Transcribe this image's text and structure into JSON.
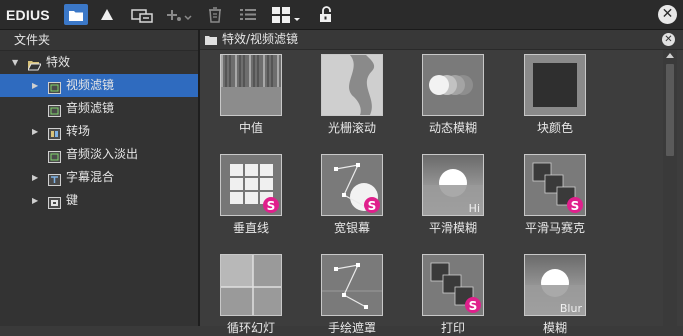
{
  "app": {
    "brand": "EDIUS"
  },
  "toolbar": {
    "buttons": [
      {
        "name": "folder-view-button",
        "icon": "folder-icon",
        "active": true
      },
      {
        "name": "effect-up-button",
        "icon": "triangle-icon"
      },
      {
        "name": "effect-link-button",
        "icon": "link-box-icon"
      },
      {
        "name": "add-effect-button",
        "icon": "plus-chevron-icon"
      },
      {
        "name": "delete-button",
        "icon": "trash-icon"
      },
      {
        "name": "list-view-button",
        "icon": "list-icon"
      },
      {
        "name": "grid-view-button",
        "icon": "grid-icon"
      },
      {
        "name": "lock-button",
        "icon": "unlock-icon"
      }
    ]
  },
  "left_panel": {
    "title": "文件夹",
    "tree": [
      {
        "label": "特效",
        "level": 0,
        "expanded": true,
        "icon": "folder-open-icon"
      },
      {
        "label": "视频滤镜",
        "level": 1,
        "expander": true,
        "icon": "filter-icon",
        "selected": true
      },
      {
        "label": "音频滤镜",
        "level": 1,
        "expander": false,
        "icon": "filter-icon"
      },
      {
        "label": "转场",
        "level": 1,
        "expander": true,
        "icon": "transition-icon"
      },
      {
        "label": "音频淡入淡出",
        "level": 1,
        "expander": false,
        "icon": "filter-icon"
      },
      {
        "label": "字幕混合",
        "level": 1,
        "expander": true,
        "icon": "title-icon"
      },
      {
        "label": "键",
        "level": 1,
        "expander": true,
        "icon": "key-icon"
      }
    ]
  },
  "right_panel": {
    "path": "特效/视频滤镜",
    "effects": [
      {
        "label": "中值",
        "thumb": "noise"
      },
      {
        "label": "光栅滚动",
        "thumb": "wave"
      },
      {
        "label": "动态模糊",
        "thumb": "motion"
      },
      {
        "label": "块颜色",
        "thumb": "block"
      },
      {
        "label": "垂直线",
        "thumb": "grid",
        "badge": "S"
      },
      {
        "label": "宽银幕",
        "thumb": "path",
        "badge": "S"
      },
      {
        "label": "平滑模糊",
        "thumb": "sun",
        "corner": "Hi"
      },
      {
        "label": "平滑马赛克",
        "thumb": "stack",
        "badge": "S"
      },
      {
        "label": "循环幻灯",
        "thumb": "split"
      },
      {
        "label": "手绘遮罩",
        "thumb": "path2"
      },
      {
        "label": "打印",
        "thumb": "stack2",
        "badge": "S"
      },
      {
        "label": "模糊",
        "thumb": "sun2",
        "corner": "Blur"
      }
    ]
  },
  "colors": {
    "accent": "#3b78c8",
    "selection": "#2f6bbf",
    "badge": "#e0208c"
  }
}
